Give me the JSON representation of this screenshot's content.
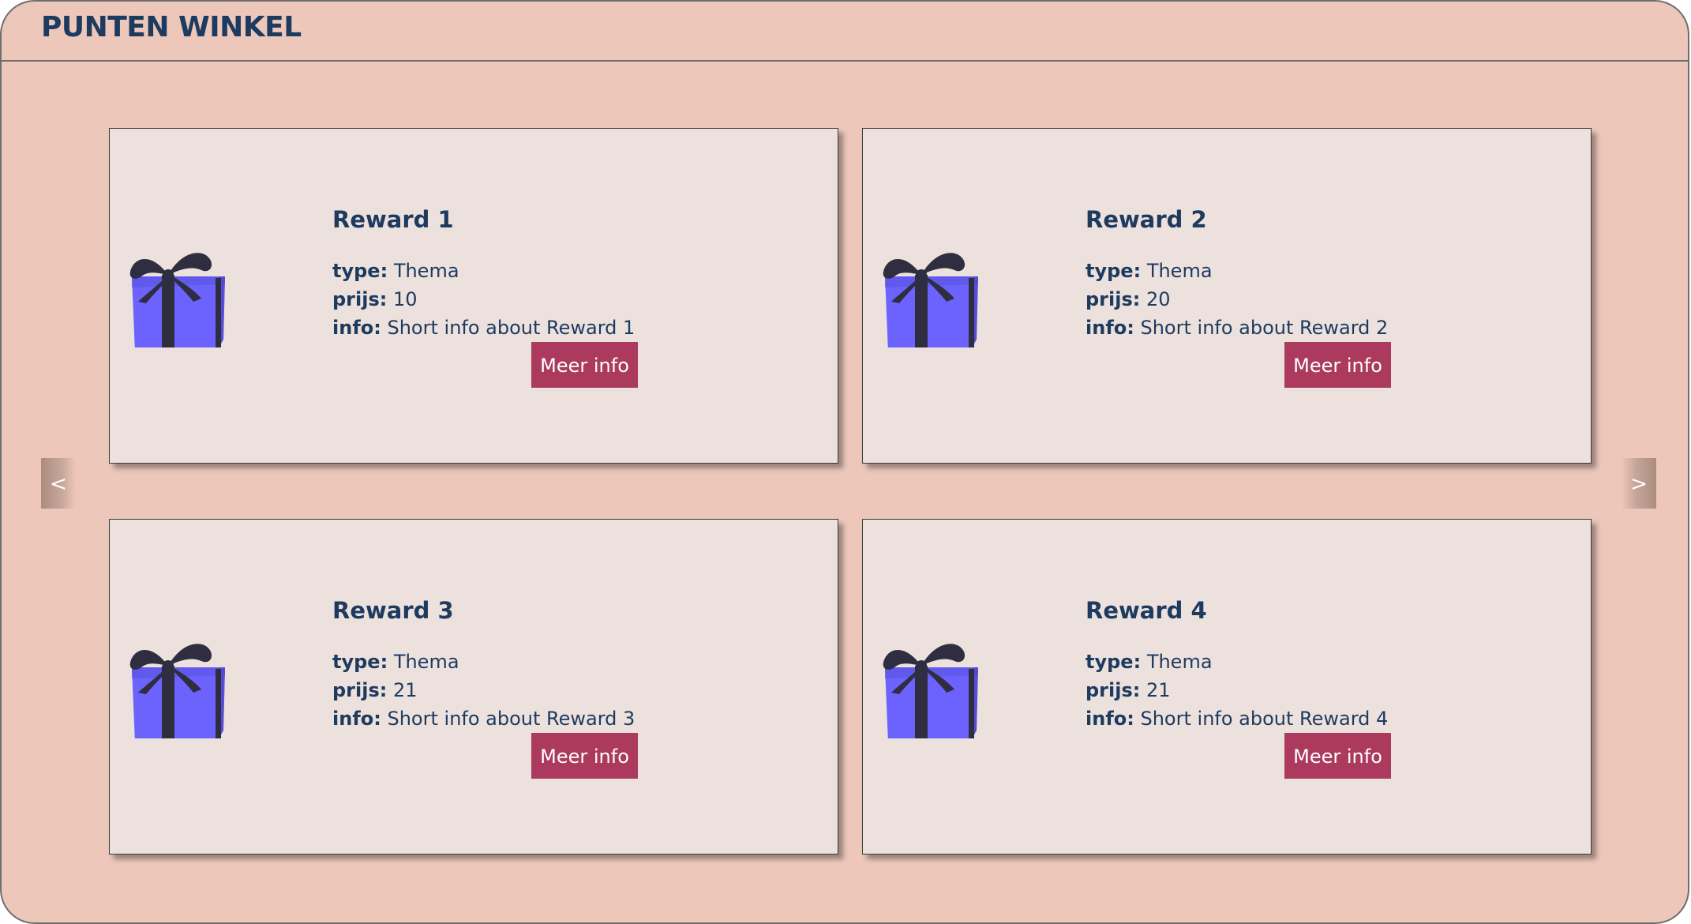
{
  "header": {
    "title": "PUNTEN WINKEL"
  },
  "navigation": {
    "prev_label": "<",
    "next_label": ">"
  },
  "field_labels": {
    "type": "type:",
    "prijs": "prijs:",
    "info": "info:"
  },
  "rewards": [
    {
      "title": "Reward 1",
      "type": "Thema",
      "prijs": "10",
      "info": "Short info about Reward 1",
      "button_label": "Meer info",
      "icon": "gift-icon"
    },
    {
      "title": "Reward 2",
      "type": "Thema",
      "prijs": "20",
      "info": "Short info about Reward 2",
      "button_label": "Meer info",
      "icon": "gift-icon"
    },
    {
      "title": "Reward 3",
      "type": "Thema",
      "prijs": "21",
      "info": "Short info about Reward 3",
      "button_label": "Meer info",
      "icon": "gift-icon"
    },
    {
      "title": "Reward 4",
      "type": "Thema",
      "prijs": "21",
      "info": "Short info about Reward 4",
      "button_label": "Meer info",
      "icon": "gift-icon"
    }
  ],
  "colors": {
    "background": "#ecc7ba",
    "card": "#ede1dd",
    "title_text": "#1d3a5f",
    "button": "#ab3a5e",
    "gift_box": "#6c63ff",
    "gift_ribbon": "#2f2e41"
  }
}
